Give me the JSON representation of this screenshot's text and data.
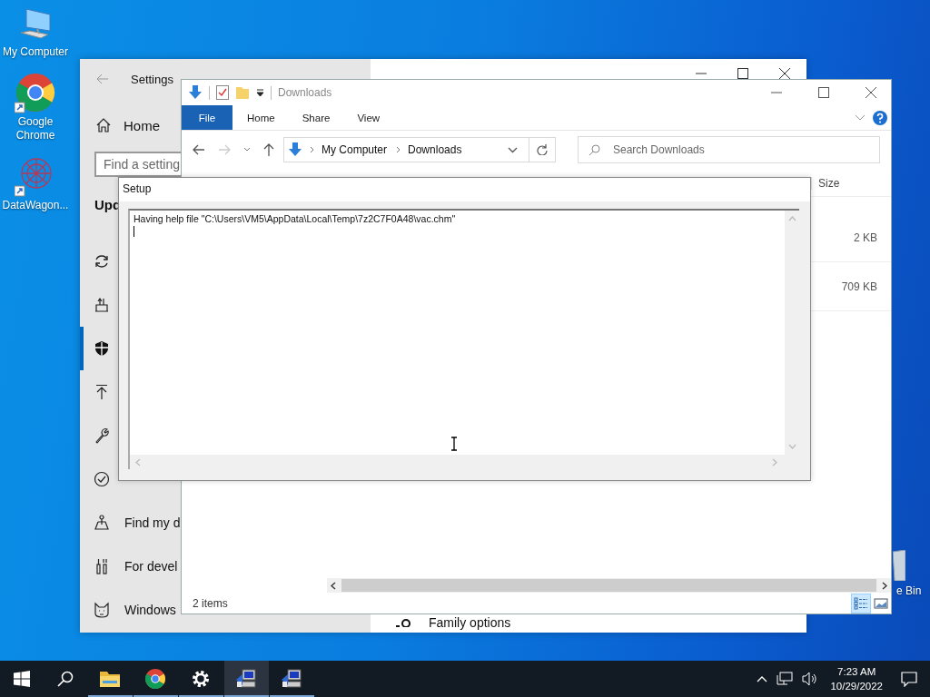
{
  "desktop_icons": [
    {
      "kind": "computer",
      "label": "My Computer"
    },
    {
      "kind": "chrome",
      "label": "Google Chrome"
    },
    {
      "kind": "app",
      "label": "DataWagon..."
    }
  ],
  "recycle_bin": {
    "label": "e Bin"
  },
  "settings": {
    "title": "Settings",
    "home": "Home",
    "search": {
      "placeholder": "Find a setting"
    },
    "heading": "Upd",
    "nav_items": [
      {
        "kind": "sync",
        "selected": false
      },
      {
        "kind": "backup",
        "selected": false
      },
      {
        "kind": "shield",
        "selected": true
      },
      {
        "kind": "upload",
        "selected": false
      },
      {
        "kind": "wrench",
        "selected": false
      },
      {
        "kind": "check",
        "selected": false
      },
      {
        "kind": "locate",
        "label": "Find my d",
        "selected": false
      },
      {
        "kind": "tools",
        "label": "For devel",
        "selected": false
      },
      {
        "kind": "cat",
        "label": "Windows",
        "selected": false
      }
    ],
    "right_item": "Family options"
  },
  "explorer": {
    "title": "Downloads",
    "ribbon_tabs": [
      {
        "label": "File",
        "selected": true
      },
      {
        "label": "Home",
        "selected": false
      },
      {
        "label": "Share",
        "selected": false
      },
      {
        "label": "View",
        "selected": false
      }
    ],
    "path": [
      "My Computer",
      "Downloads"
    ],
    "search": {
      "placeholder": "Search Downloads"
    },
    "size_column": "Size",
    "rows": [
      {
        "size": "2 KB"
      },
      {
        "size": "709 KB"
      }
    ],
    "status": "2 items",
    "views": [
      {
        "kind": "details",
        "selected": true
      },
      {
        "kind": "large_icons",
        "selected": false
      }
    ]
  },
  "setup": {
    "title": "Setup",
    "log": "Having help file \"C:\\Users\\VM5\\AppData\\Local\\Temp\\7z2C7F0A48\\vac.chm\""
  },
  "taskbar": {
    "apps": [
      {
        "kind": "explorer",
        "selected": false
      },
      {
        "kind": "chrome",
        "selected": false
      },
      {
        "kind": "settings",
        "selected": false
      },
      {
        "kind": "setup",
        "selected": true
      },
      {
        "kind": "setup",
        "selected": false
      }
    ],
    "time": "7:23 AM",
    "date": "10/29/2022"
  }
}
